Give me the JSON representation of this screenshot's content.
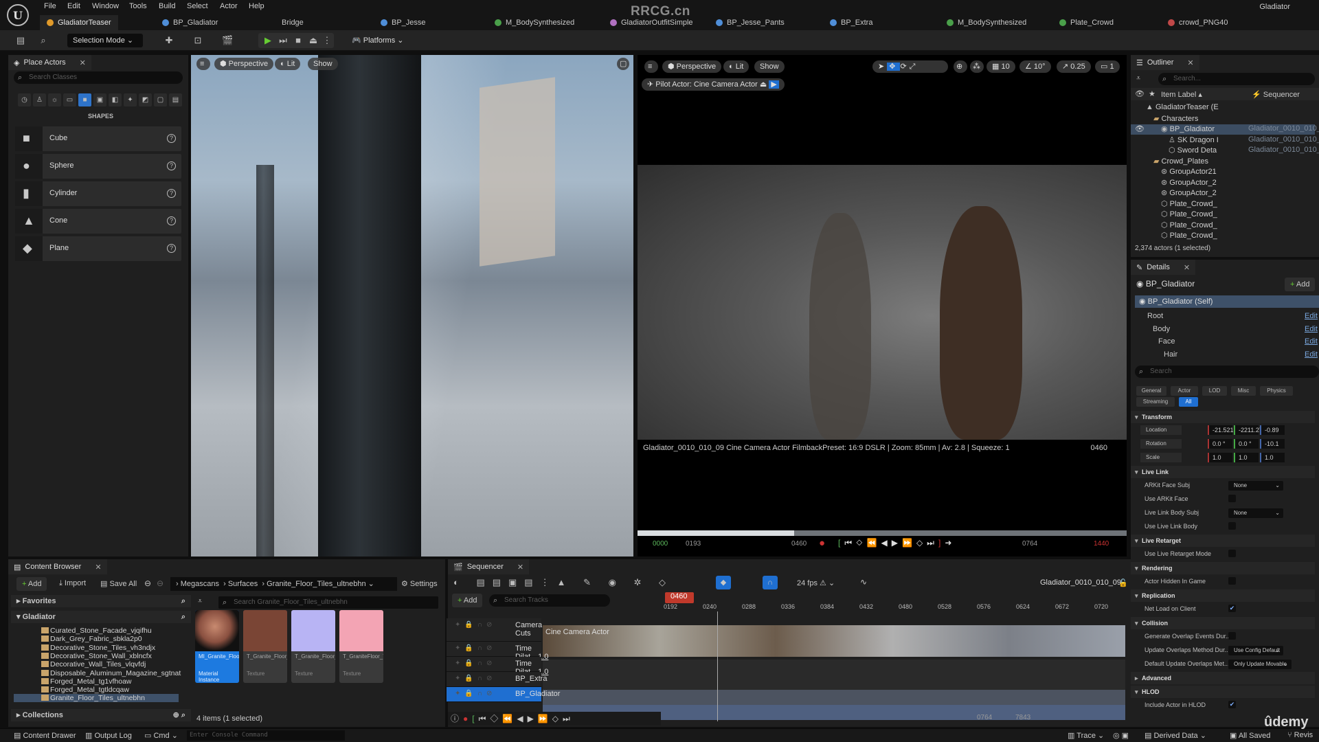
{
  "app": {
    "menu": [
      "File",
      "Edit",
      "Window",
      "Tools",
      "Build",
      "Select",
      "Actor",
      "Help"
    ],
    "project_name": "Gladiator",
    "watermark": "RRCG.cn",
    "doc_tabs": [
      {
        "label": "GladiatorTeaser",
        "color": "#e09a2a",
        "active": true
      },
      {
        "label": "BP_Gladiator",
        "color": "#4f8ed8",
        "active": false
      },
      {
        "label": "Bridge",
        "color": "",
        "active": false
      },
      {
        "label": "BP_Jesse",
        "color": "#4f8ed8",
        "active": false
      },
      {
        "label": "M_BodySynthesized",
        "color": "#4aa04a",
        "active": false
      },
      {
        "label": "GladiatorOutfitSimple",
        "color": "#b070c0",
        "active": false
      },
      {
        "label": "BP_Jesse_Pants",
        "color": "#4f8ed8",
        "active": false
      },
      {
        "label": "BP_Extra",
        "color": "#4f8ed8",
        "active": false
      },
      {
        "label": "M_BodySynthesized",
        "color": "#4aa04a",
        "active": false
      },
      {
        "label": "Plate_Crowd",
        "color": "#4aa04a",
        "active": false
      },
      {
        "label": "crowd_PNG40",
        "color": "#c04848",
        "active": false
      }
    ]
  },
  "toolbar": {
    "selection_mode": "Selection Mode",
    "platforms": "Platforms"
  },
  "place_actors": {
    "title": "Place Actors",
    "search_placeholder": "Search Classes",
    "category_label": "SHAPES",
    "category_icons": [
      "clock-icon",
      "actor-icon",
      "light-icon",
      "cinematic-icon",
      "shapes-icon",
      "visual-effects-icon",
      "volumes-icon",
      "fx-icon",
      "geometry-icon",
      "frame-icon",
      "all-classes-icon"
    ],
    "shapes": [
      "Cube",
      "Sphere",
      "Cylinder",
      "Cone",
      "Plane"
    ]
  },
  "viewport_left": {
    "view": "Perspective",
    "lighting": "Lit",
    "show": "Show"
  },
  "viewport_right": {
    "view": "Perspective",
    "lighting": "Lit",
    "show": "Show",
    "grid_snap": "10",
    "rotation_snap": "10°",
    "scale_snap": "0.25",
    "camera_speed": "1",
    "pilot_actor": "Pilot Actor: Cine Camera Actor",
    "camera_info": "Gladiator_0010_010_09 Cine Camera Actor   FilmbackPreset: 16:9 DSLR | Zoom: 85mm | Av: 2.8 | Squeeze: 1",
    "current_frame": "0460",
    "timeline": {
      "start": "0000",
      "in": "0193",
      "current": "0460",
      "out": "0764",
      "end": "1440",
      "playhead_fraction": 0.32
    }
  },
  "outliner": {
    "title": "Outliner",
    "search_placeholder": "Search...",
    "col_label": "Item Label",
    "col_sequencer": "Sequencer",
    "rows": [
      {
        "label": "GladiatorTeaser (E",
        "seq": "",
        "indent": 2,
        "icon": "level-icon",
        "selected": false
      },
      {
        "label": "Characters",
        "seq": "",
        "indent": 3,
        "icon": "folder-icon",
        "selected": false
      },
      {
        "label": "BP_Gladiator",
        "seq": "Gladiator_0010_010_0",
        "indent": 4,
        "icon": "blueprint-icon",
        "selected": true
      },
      {
        "label": "SK Dragon I",
        "seq": "Gladiator_0010_010_0",
        "indent": 5,
        "icon": "skeletal-icon",
        "selected": false
      },
      {
        "label": "Sword Deta",
        "seq": "Gladiator_0010_010_0",
        "indent": 5,
        "icon": "mesh-icon",
        "selected": false
      },
      {
        "label": "Crowd_Plates",
        "seq": "",
        "indent": 3,
        "icon": "folder-icon",
        "selected": false
      },
      {
        "label": "GroupActor21",
        "seq": "",
        "indent": 4,
        "icon": "group-icon",
        "selected": false
      },
      {
        "label": "GroupActor_2",
        "seq": "",
        "indent": 4,
        "icon": "group-icon",
        "selected": false
      },
      {
        "label": "GroupActor_2",
        "seq": "",
        "indent": 4,
        "icon": "group-icon",
        "selected": false
      },
      {
        "label": "Plate_Crowd_",
        "seq": "",
        "indent": 4,
        "icon": "mesh-icon",
        "selected": false
      },
      {
        "label": "Plate_Crowd_",
        "seq": "",
        "indent": 4,
        "icon": "mesh-icon",
        "selected": false
      },
      {
        "label": "Plate_Crowd_",
        "seq": "",
        "indent": 4,
        "icon": "mesh-icon",
        "selected": false
      },
      {
        "label": "Plate_Crowd_",
        "seq": "",
        "indent": 4,
        "icon": "mesh-icon",
        "selected": false
      }
    ],
    "footer": "2,374 actors (1 selected)"
  },
  "details": {
    "title": "Details",
    "actor": "BP_Gladiator",
    "add_label": "Add",
    "self_label": "BP_Gladiator (Self)",
    "components": [
      {
        "label": "Root",
        "edit": "Edit"
      },
      {
        "label": "Body",
        "edit": "Edit"
      },
      {
        "label": "Face",
        "edit": "Edit"
      },
      {
        "label": "Hair",
        "edit": "Edit"
      }
    ],
    "search_placeholder": "Search",
    "filter_tabs": [
      "General",
      "Actor",
      "LOD",
      "Misc",
      "Physics",
      "Streaming",
      "All"
    ],
    "active_filter": "All",
    "transform": {
      "title": "Transform",
      "location": {
        "label": "Location",
        "x": "-21.52135",
        "y": "-2211.278",
        "z": "-0.89"
      },
      "rotation": {
        "label": "Rotation",
        "x": "0.0 °",
        "y": "0.0 °",
        "z": "-10.1"
      },
      "scale": {
        "label": "Scale",
        "x": "1.0",
        "y": "1.0",
        "z": "1.0"
      }
    },
    "live_link": {
      "title": "Live Link",
      "arkit_face_subj": {
        "label": "ARKit Face Subj",
        "value": "None"
      },
      "use_arkit_face": {
        "label": "Use ARKit Face",
        "checked": false
      },
      "body_subj": {
        "label": "Live Link Body Subj",
        "value": "None"
      },
      "use_body": {
        "label": "Use Live Link Body",
        "checked": false
      }
    },
    "live_retarget": {
      "title": "Live Retarget",
      "mode": {
        "label": "Use Live Retarget Mode",
        "checked": false
      }
    },
    "rendering": {
      "title": "Rendering",
      "hidden": {
        "label": "Actor Hidden In Game",
        "checked": false
      }
    },
    "replication": {
      "title": "Replication",
      "net_load": {
        "label": "Net Load on Client",
        "checked": true
      }
    },
    "collision": {
      "title": "Collision",
      "gen_overlap": {
        "label": "Generate Overlap Events Dur...",
        "checked": false
      },
      "update_method": {
        "label": "Update Overlaps Method Dur...",
        "value": "Use Config Default"
      },
      "default_method": {
        "label": "Default Update Overlaps Met...",
        "value": "Only Update Movable"
      }
    },
    "advanced": "Advanced",
    "hlod": {
      "title": "HLOD",
      "include": {
        "label": "Include Actor in HLOD",
        "checked": true
      }
    }
  },
  "content_browser": {
    "title": "Content Browser",
    "add": "Add",
    "import": "Import",
    "save_all": "Save All",
    "breadcrumb": [
      "Megascans",
      "Surfaces",
      "Granite_Floor_Tiles_ultnebhn"
    ],
    "settings": "Settings",
    "favorites": "Favorites",
    "root": "Gladiator",
    "folders": [
      "Curated_Stone_Facade_vjqifhu",
      "Dark_Grey_Fabric_sbkla2p0",
      "Decorative_Stone_Tiles_vh3ndjx",
      "Decorative_Stone_Wall_xblncfx",
      "Decorative_Wall_Tiles_vlqvfdj",
      "Disposable_Aluminum_Magazine_sgtnat",
      "Forged_Metal_tg1vfhoaw",
      "Forged_Metal_tgtldcqaw",
      "Granite_Floor_Tiles_ultnebhn"
    ],
    "selected_folder": "Granite_Floor_Tiles_ultnebhn",
    "collections": "Collections",
    "search_placeholder": "Search Granite_Floor_Tiles_ultnebhn",
    "assets": [
      {
        "name": "MI_Granite_Floor_Tiles_",
        "type": "Material Instance",
        "color": "#8a5040",
        "selected": true
      },
      {
        "name": "T_Granite_Floor_Tiles_ultnebhn_",
        "type": "Texture",
        "color": "#7a4535",
        "selected": false
      },
      {
        "name": "T_Granite_Floor_Tiles_ultnebhn_",
        "type": "Texture",
        "color": "#b8b4f4",
        "selected": false
      },
      {
        "name": "T_GraniteFloor_Tiles_ultnebhn_",
        "type": "Texture",
        "color": "#f3a4b4",
        "selected": false
      }
    ],
    "item_count": "4 items (1 selected)"
  },
  "sequencer": {
    "title": "Sequencer",
    "fps": "24 fps",
    "sequence_name": "Gladiator_0010_010_09",
    "add": "Add",
    "search_placeholder": "Search Tracks",
    "current_frame": "0460",
    "ticks": [
      "0192",
      "0240",
      "0288",
      "0336",
      "0384",
      "0432",
      "0480",
      "0528",
      "0576",
      "0624",
      "0672",
      "0720"
    ],
    "tracks": [
      {
        "name": "Camera Cuts",
        "value": "",
        "selected": false
      },
      {
        "name": "Time Dilat.",
        "value": "1.0",
        "selected": false
      },
      {
        "name": "Time Dilat.",
        "value": "1.0",
        "selected": false
      },
      {
        "name": "BP_Extra",
        "value": "",
        "selected": false
      },
      {
        "name": "BP_Gladiator",
        "value": "",
        "selected": true
      }
    ],
    "camera_clip_label": "Cine Camera Actor",
    "range_out": "0764",
    "range_end": "7843"
  },
  "statusbar": {
    "content_drawer": "Content Drawer",
    "output_log": "Output Log",
    "cmd": "Cmd",
    "console_placeholder": "Enter Console Command",
    "trace": "Trace",
    "derived_data": "Derived Data",
    "all_saved": "All Saved",
    "revision": "Revis",
    "udemy": "ûdemy"
  }
}
